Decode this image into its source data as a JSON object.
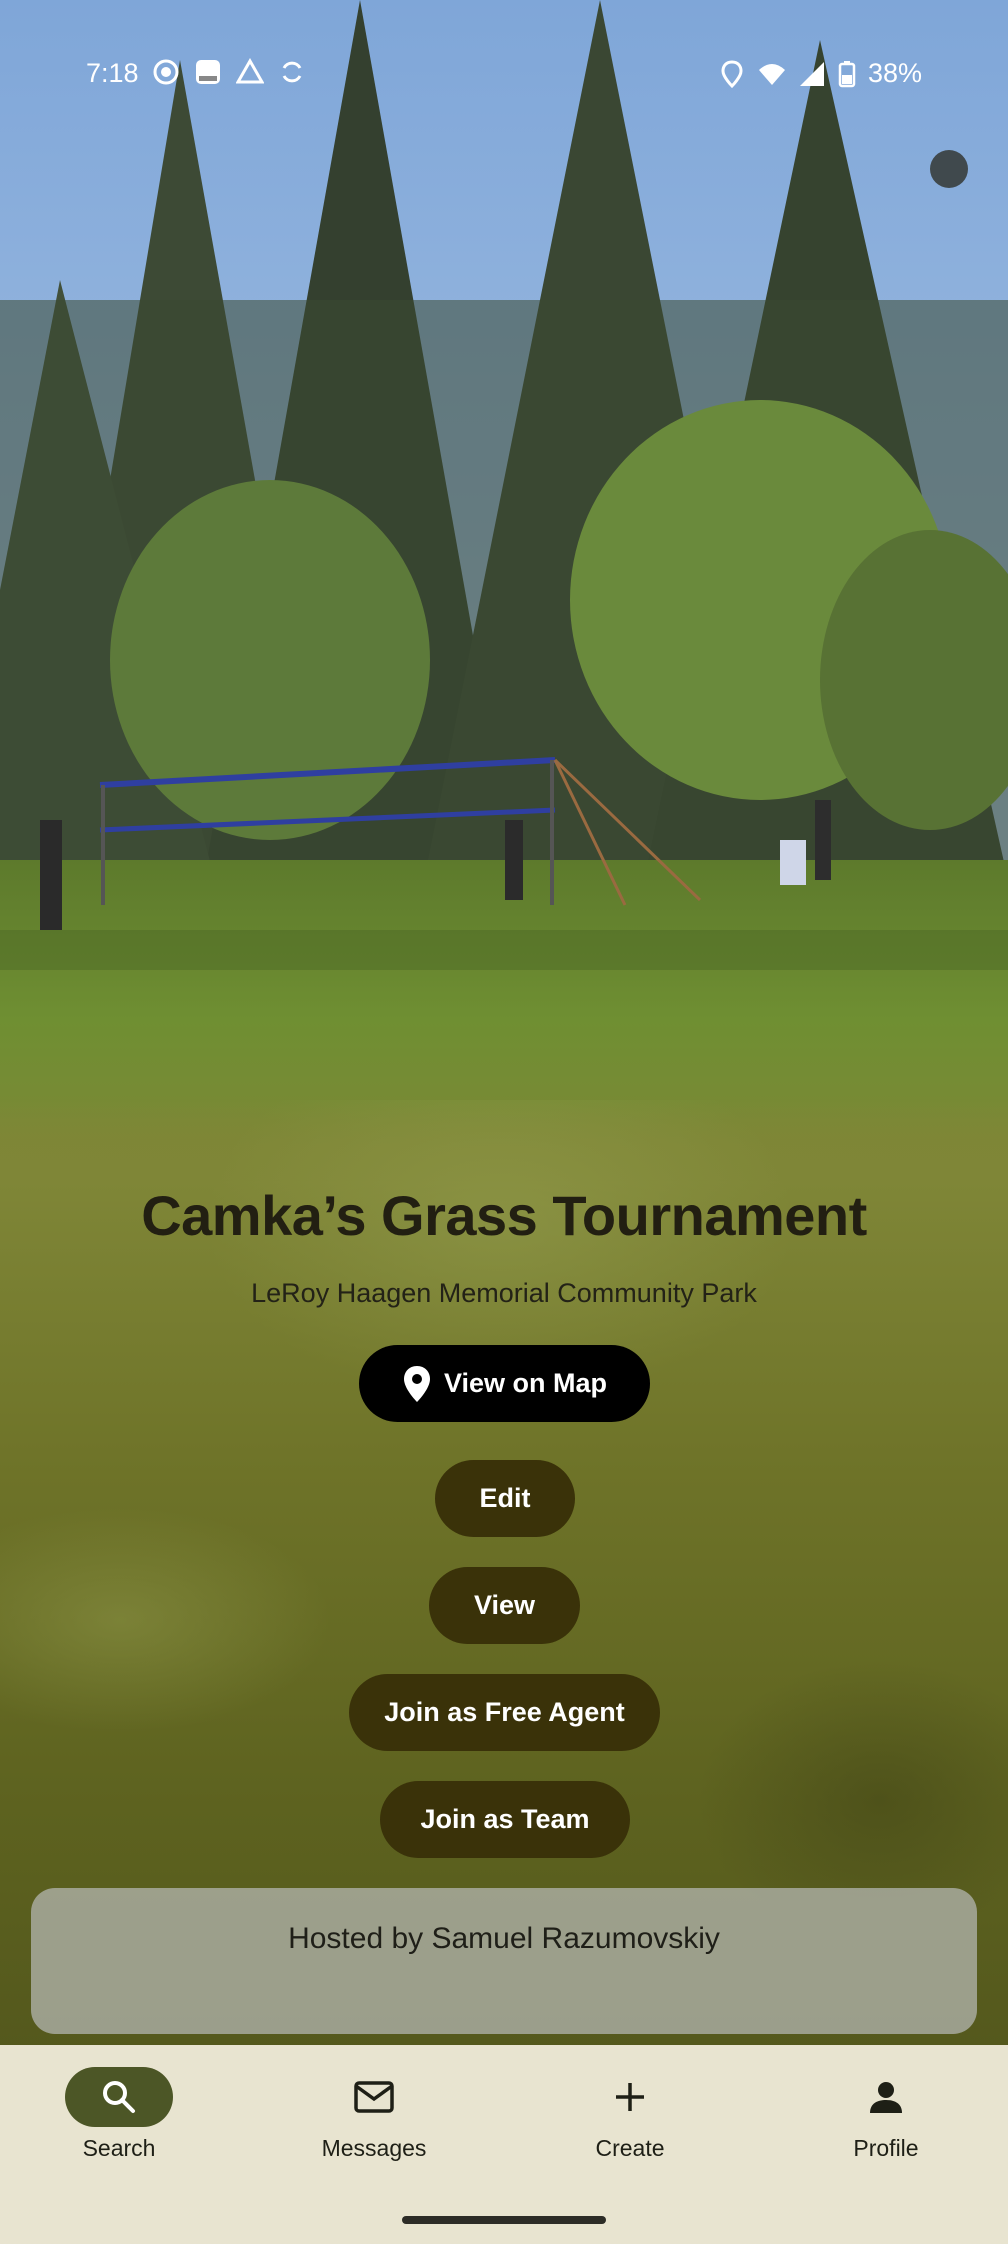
{
  "status_bar": {
    "time": "7:18",
    "battery": "38%",
    "left_icons": [
      "screen-record-icon",
      "notification-icon",
      "drive-icon",
      "sync-icon"
    ],
    "right_icons": [
      "location-icon",
      "wifi-icon",
      "signal-icon",
      "battery-icon"
    ]
  },
  "event": {
    "title": "Camka’s Grass Tournament",
    "location": "LeRoy Haagen Memorial Community Park"
  },
  "actions": {
    "view_on_map": "View on Map",
    "edit": "Edit",
    "view": "View",
    "join_free_agent": "Join as Free Agent",
    "join_team": "Join as Team"
  },
  "host": {
    "label": "Hosted by Samuel Razumovskiy"
  },
  "nav": {
    "items": [
      {
        "label": "Search",
        "icon": "search-icon",
        "active": true
      },
      {
        "label": "Messages",
        "icon": "mail-icon",
        "active": false
      },
      {
        "label": "Create",
        "icon": "plus-icon",
        "active": false
      },
      {
        "label": "Profile",
        "icon": "person-icon",
        "active": false
      }
    ]
  },
  "colors": {
    "primary_button": "#000000",
    "secondary_button": "#3a3209",
    "nav_background": "#e8e4d0",
    "nav_active_pill": "#4c5626"
  }
}
